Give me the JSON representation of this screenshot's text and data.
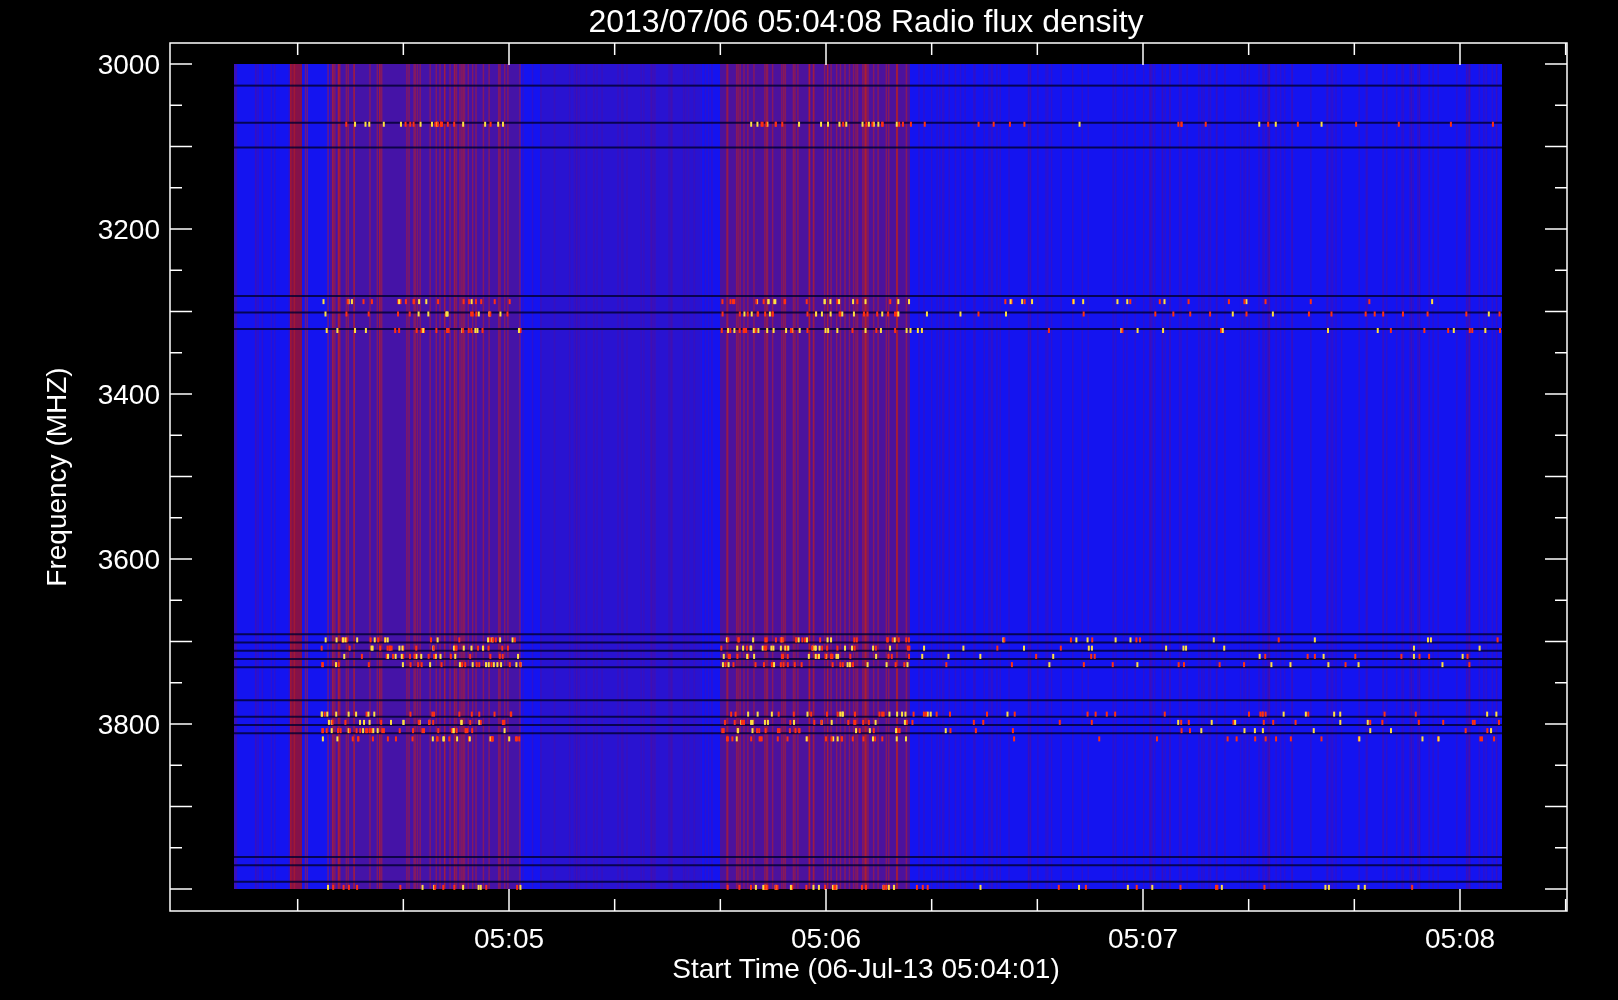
{
  "plot": {
    "title": "2013/07/06 05:04:08 Radio flux density",
    "ylabel": "Frequency (MHZ)",
    "xlabel": "Start Time (06-Jul-13 05:04:01)",
    "y_tick_labels": [
      "3000",
      "3200",
      "3400",
      "3600",
      "3800"
    ],
    "x_tick_labels": [
      "05:05",
      "05:06",
      "05:07",
      "05:08"
    ]
  }
}
